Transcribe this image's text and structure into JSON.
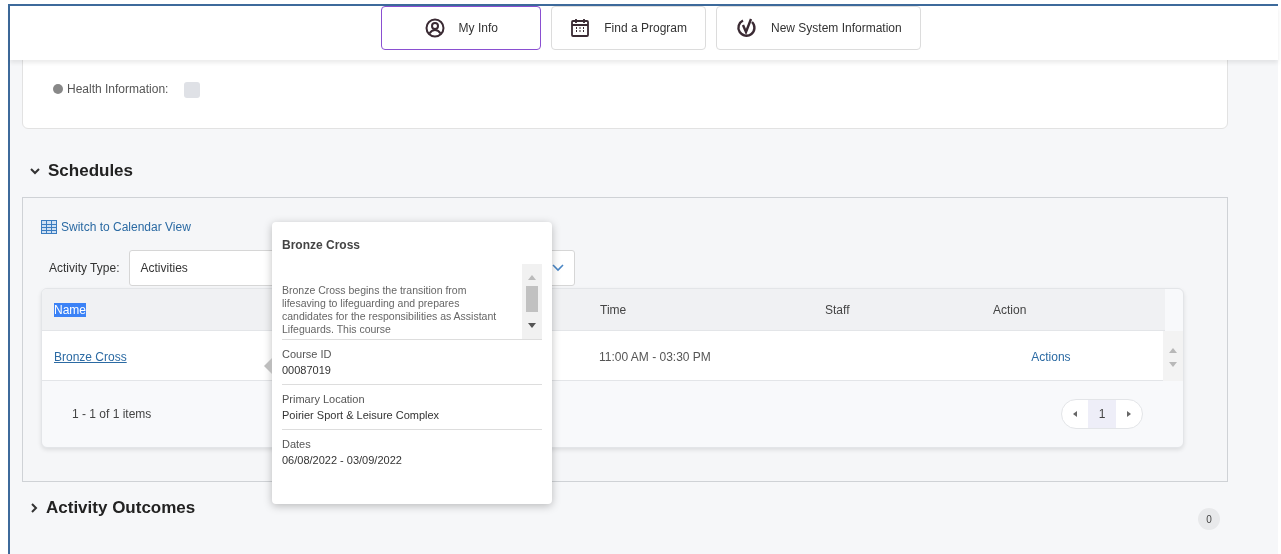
{
  "nav": [
    {
      "label": "My Info",
      "selected": true
    },
    {
      "label": "Find a Program",
      "selected": false
    },
    {
      "label": "New System Information",
      "selected": false
    }
  ],
  "health": {
    "label": "Health Information:",
    "checked": false
  },
  "schedules": {
    "title": "Schedules",
    "expanded": true,
    "calendar_link": "Switch to Calendar View",
    "activity_type": {
      "label": "Activity Type:",
      "value": "Activities"
    },
    "table": {
      "columns": [
        {
          "label": "Name",
          "selected": true
        },
        {
          "label": "Time",
          "selected": false
        },
        {
          "label": "Staff",
          "selected": false
        },
        {
          "label": "Action",
          "selected": false
        }
      ],
      "rows": [
        {
          "name": "Bronze Cross",
          "time": "11:00 AM - 03:30 PM",
          "action": "Actions"
        }
      ],
      "summary": "1 - 1 of 1 items",
      "pages": [
        {
          "label": "1",
          "selected": true
        }
      ]
    }
  },
  "tooltip": {
    "title": "Bronze Cross",
    "description": "Bronze Cross begins the transition from lifesaving to lifeguarding and prepares candidates for the responsibilities as Assistant Lifeguards. This course",
    "fields": [
      {
        "label": "Course ID",
        "value": "00087019"
      },
      {
        "label": "Primary Location",
        "value": "Poirier Sport & Leisure Complex"
      },
      {
        "label": "Dates",
        "value": "06/08/2022 - 03/09/2022"
      }
    ]
  },
  "activity_outcomes": {
    "title": "Activity Outcomes",
    "expanded": false,
    "count": "0"
  }
}
